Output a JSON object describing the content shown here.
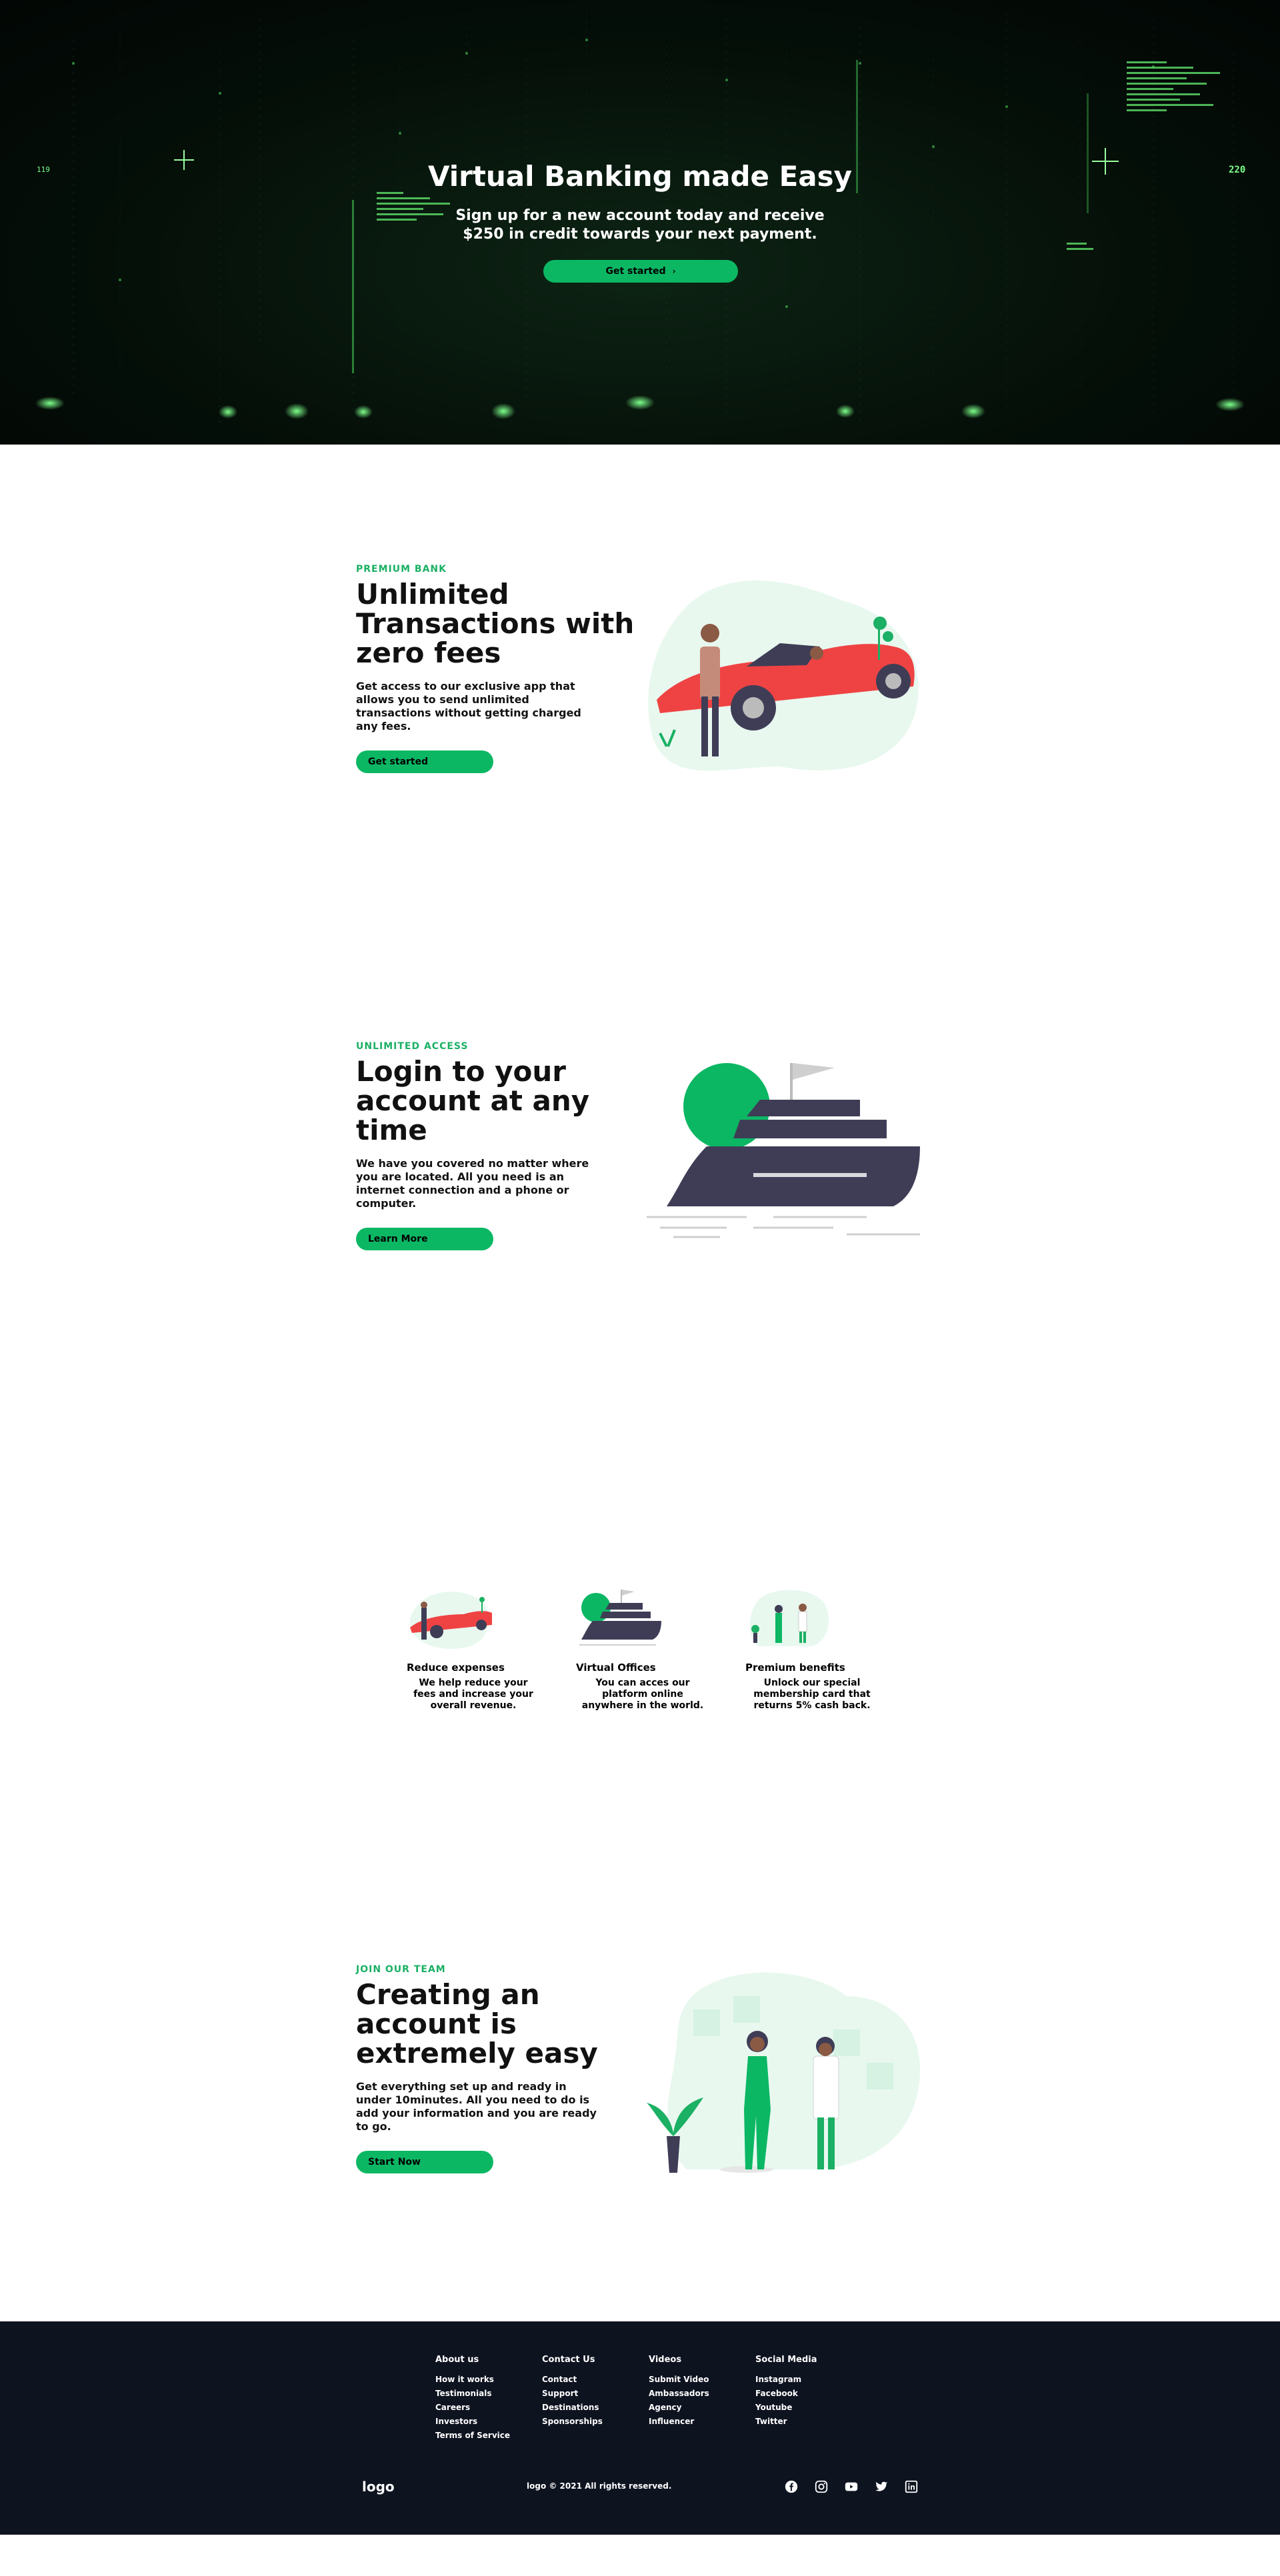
{
  "hero": {
    "title": "Virtual Banking made Easy",
    "subtitle": "Sign up for a new account today and receive $250 in credit towards your next payment.",
    "cta": "Get started",
    "corner_left": "119",
    "corner_right": "220"
  },
  "sections": [
    {
      "eyebrow": "PREMIUM BANK",
      "title": "Unlimited Transactions with zero fees",
      "body": "Get access to our exclusive app that allows you to send unlimited transactions without getting charged any fees.",
      "cta": "Get started"
    },
    {
      "eyebrow": "UNLIMITED ACCESS",
      "title": "Login to your account at any time",
      "body": "We have you covered no matter where you are located. All you need is an internet connection and a phone or computer.",
      "cta": "Learn More"
    },
    {
      "eyebrow": "JOIN OUR TEAM",
      "title": "Creating an account is extremely easy",
      "body": "Get everything set up and ready in under 10minutes. All you need to do is add your information and you are ready to go.",
      "cta": "Start Now"
    }
  ],
  "cards": [
    {
      "title": "Reduce expenses",
      "body": "We help reduce your fees and increase your overall revenue."
    },
    {
      "title": "Virtual Offices",
      "body": "You can acces our platform online anywhere in the world."
    },
    {
      "title": "Premium benefits",
      "body": "Unlock our special membership card that returns 5% cash back."
    }
  ],
  "footer": {
    "columns": [
      {
        "heading": "About us",
        "links": [
          "How it works",
          "Testimonials",
          "Careers",
          "Investors",
          "Terms of Service"
        ]
      },
      {
        "heading": "Contact Us",
        "links": [
          "Contact",
          "Support",
          "Destinations",
          "Sponsorships"
        ]
      },
      {
        "heading": "Videos",
        "links": [
          "Submit Video",
          "Ambassadors",
          "Agency",
          "Influencer"
        ]
      },
      {
        "heading": "Social Media",
        "links": [
          "Instagram",
          "Facebook",
          "Youtube",
          "Twitter"
        ]
      }
    ],
    "logo": "logo",
    "copyright": "logo © 2021 All rights reserved.",
    "social_icons": [
      "facebook-icon",
      "instagram-icon",
      "youtube-icon",
      "twitter-icon",
      "linkedin-icon"
    ]
  },
  "colors": {
    "accent": "#0cb764",
    "footer_bg": "#0e1320",
    "dark_illus": "#3f3d56"
  }
}
